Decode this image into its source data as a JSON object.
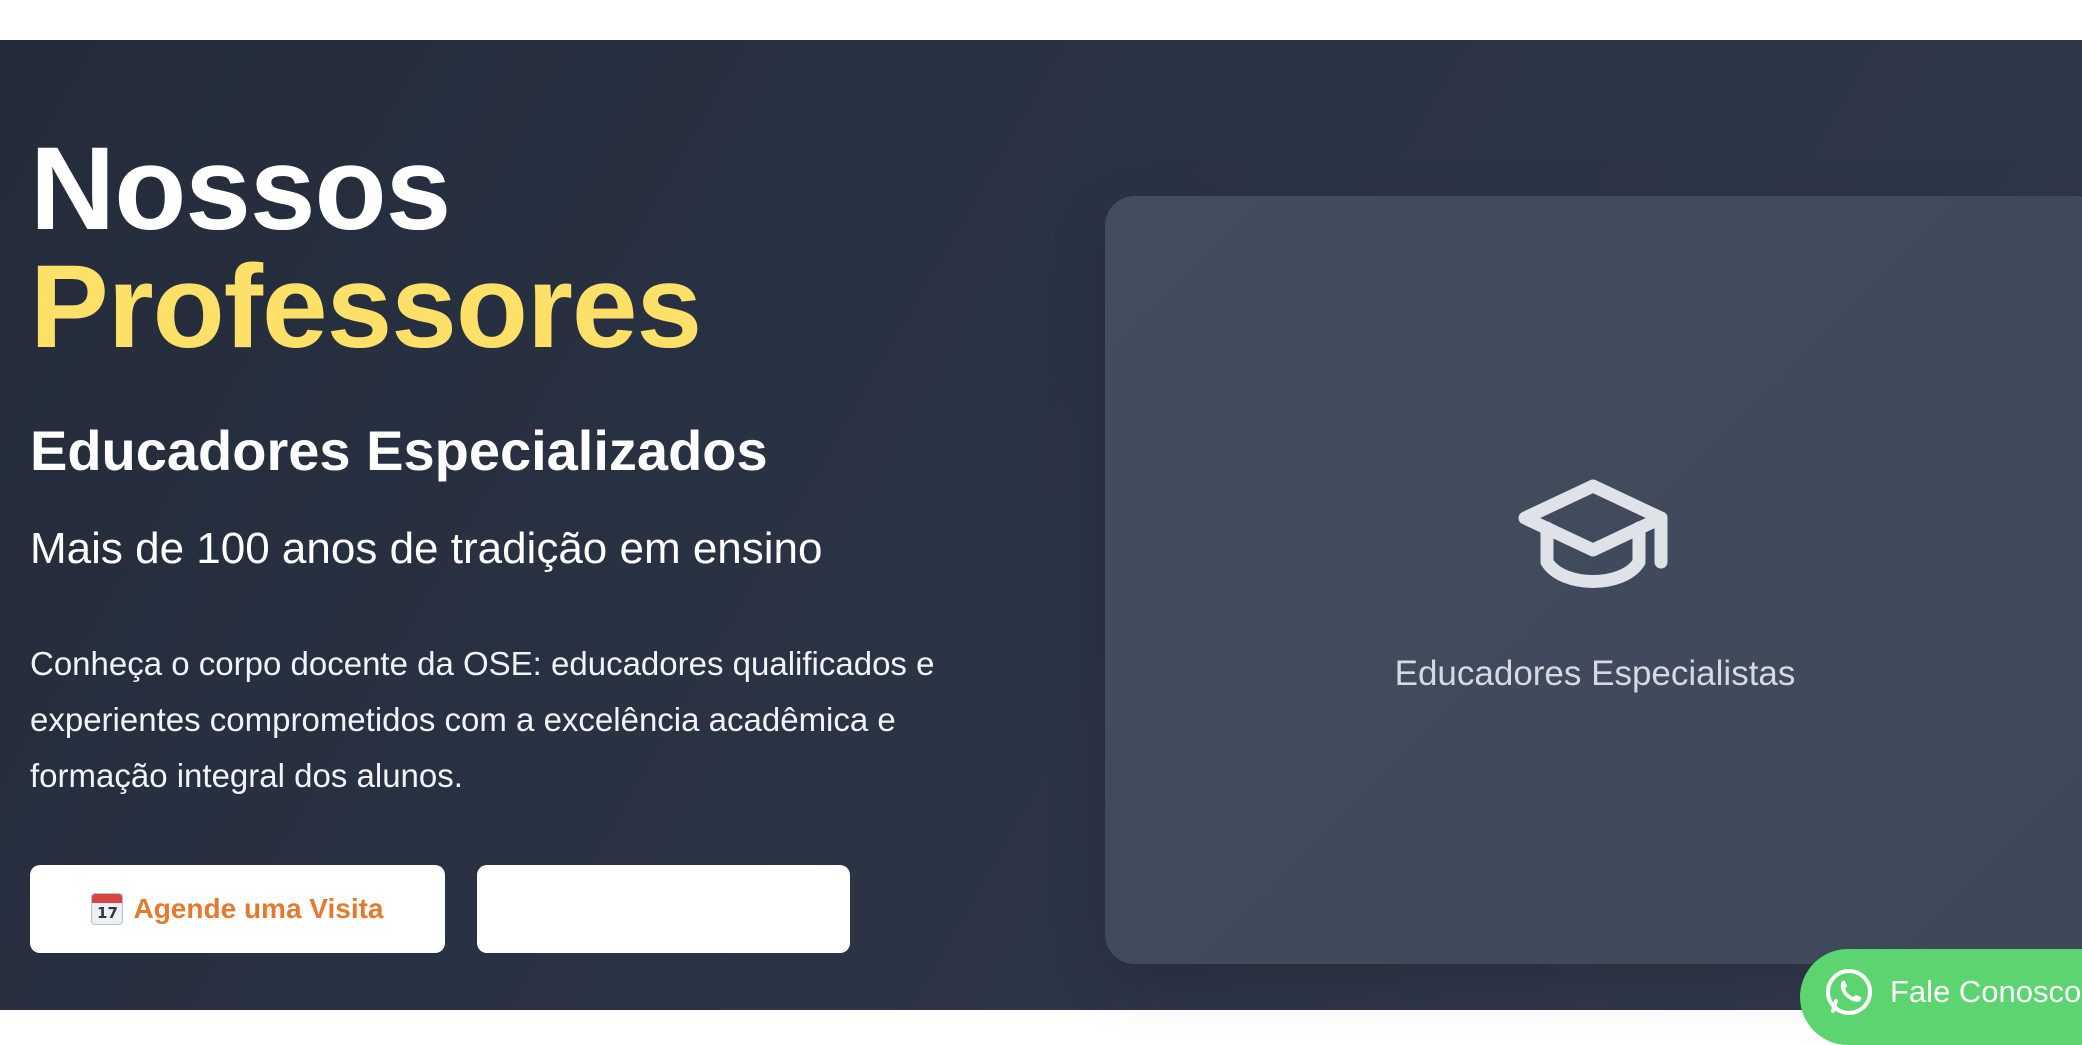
{
  "hero": {
    "title_line1": "Nossos",
    "title_line2": "Professores",
    "subtitle": "Educadores Especializados",
    "tagline": "Mais de 100 anos de tradição em ensino",
    "description": "Conheça o corpo docente da OSE: educadores qualificados e experientes comprometidos com a excelência acadêmica e formação integral dos alunos.",
    "primary_button": {
      "label": "Agende uma Visita",
      "icon": "calendar-icon"
    },
    "secondary_button": {
      "label": ""
    }
  },
  "card": {
    "icon": "graduation-cap-icon",
    "label": "Educadores Especialistas"
  },
  "whatsapp": {
    "label": "Fale Conosco",
    "icon": "whatsapp-icon"
  },
  "colors": {
    "hero_bg": "#2a3344",
    "accent_yellow": "#fde068",
    "button_text": "#e47a2f",
    "whatsapp_green": "#5cd571",
    "card_bg": "#424d5f"
  }
}
